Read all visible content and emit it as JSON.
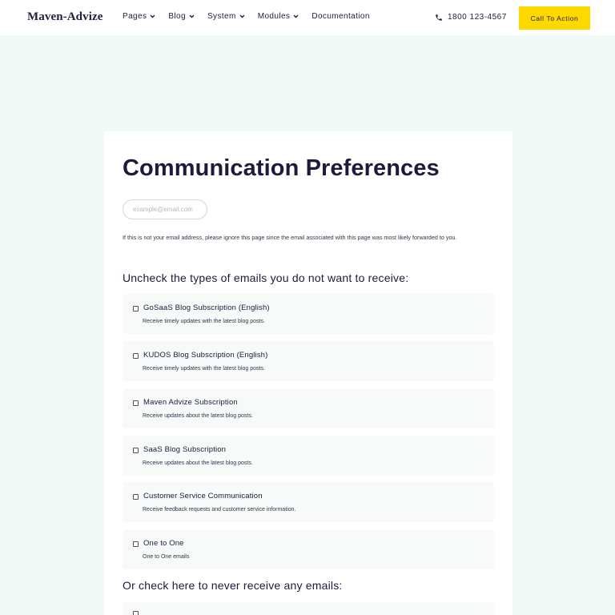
{
  "header": {
    "logo": "Maven-Advize",
    "nav": [
      {
        "label": "Pages",
        "has_dropdown": true
      },
      {
        "label": "Blog",
        "has_dropdown": true
      },
      {
        "label": "System",
        "has_dropdown": true
      },
      {
        "label": "Modules",
        "has_dropdown": true
      },
      {
        "label": "Documentation",
        "has_dropdown": false
      }
    ],
    "phone": "1800 123-4567",
    "cta_label": "Call To Action"
  },
  "colors": {
    "page_bg": "#f2faf8",
    "text": "#1c1b3c",
    "cta": "#ffd800"
  },
  "form": {
    "title": "Communication Preferences",
    "email_placeholder": "example@email.com",
    "note": "If this is not your email address, please ignore this page since the email associated with this page was most likely forwarded to you.",
    "uncheck_heading": "Uncheck the types of emails you do not want to receive:",
    "options": [
      {
        "name": "GoSaaS Blog Subscription (English)",
        "description": "Receive timely updates with the latest blog posts.",
        "checked": false
      },
      {
        "name": "KUDOS Blog Subscription (English)",
        "description": "Receive timely updates with the latest blog posts.",
        "checked": false
      },
      {
        "name": "Maven Advize Subscription",
        "description": "Receive updates about the latest blog posts.",
        "checked": false
      },
      {
        "name": "SaaS Blog Subscription",
        "description": "Receive updates about the latest blog posts.",
        "checked": false
      },
      {
        "name": "Customer Service Communication",
        "description": "Receive feedback requests and customer service information.",
        "checked": false
      },
      {
        "name": "One to One",
        "description": "One to One emails",
        "checked": false
      }
    ],
    "unsubscribe_heading": "Or check here to never receive any emails:"
  }
}
